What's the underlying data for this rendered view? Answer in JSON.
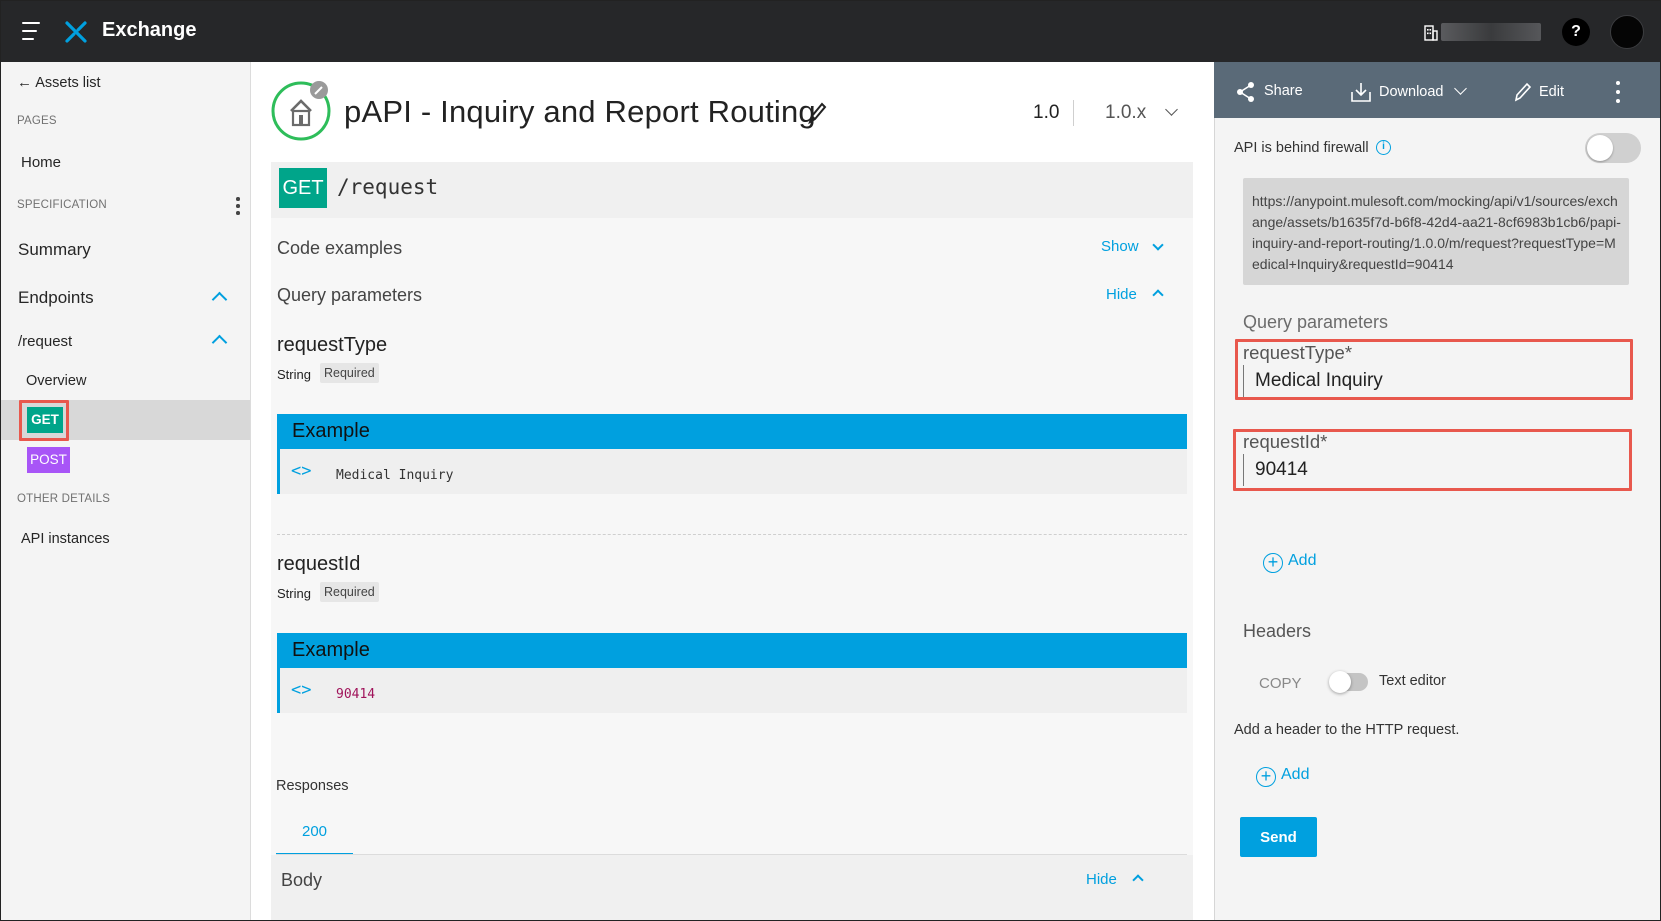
{
  "topbar": {
    "app_title": "Exchange",
    "help_label": "?"
  },
  "sidebar": {
    "back_label": "Assets list",
    "pages_title": "PAGES",
    "home_label": "Home",
    "spec_title": "SPECIFICATION",
    "summary_label": "Summary",
    "endpoints_label": "Endpoints",
    "resource_label": "/request",
    "overview_label": "Overview",
    "get_label": "GET",
    "post_label": "POST",
    "other_title": "OTHER DETAILS",
    "api_instances_label": "API instances"
  },
  "asset": {
    "title": "pAPI - Inquiry and Report Routing",
    "version": "1.0",
    "version_selector": "1.0.x"
  },
  "endpoint": {
    "method": "GET",
    "path": "/request",
    "code_examples_label": "Code examples",
    "show_label": "Show",
    "query_params_label": "Query parameters",
    "hide_label": "Hide",
    "params": [
      {
        "name": "requestType",
        "type": "String",
        "required": "Required",
        "example_title": "Example",
        "example_value": "Medical Inquiry"
      },
      {
        "name": "requestId",
        "type": "String",
        "required": "Required",
        "example_title": "Example",
        "example_value": "90414"
      }
    ],
    "responses_label": "Responses",
    "response_tab": "200",
    "body_label": "Body",
    "body_hide_label": "Hide"
  },
  "console": {
    "share_label": "Share",
    "download_label": "Download",
    "edit_label": "Edit",
    "firewall_label": "API is behind firewall",
    "firewall_info": "i",
    "url": "https://anypoint.mulesoft.com/mocking/api/v1/sources/exchange/assets/b1635f7d-b6f8-42d4-aa21-8cf6983b1cb6/papi-inquiry-and-report-routing/1.0.0/m/request?requestType=Medical+Inquiry&requestId=90414",
    "query_params_label": "Query parameters",
    "fields": [
      {
        "label": "requestType*",
        "value": "Medical Inquiry"
      },
      {
        "label": "requestId*",
        "value": "90414"
      }
    ],
    "add_label": "Add",
    "headers_label": "Headers",
    "copy_label": "COPY",
    "text_editor_label": "Text editor",
    "header_hint": "Add a header to the HTTP request.",
    "send_label": "Send"
  },
  "colors": {
    "topbar": "#262729",
    "accent": "#00a0df",
    "get_method": "#00a58a",
    "post_method": "#a855f7",
    "highlight": "#e8584d",
    "console_bar": "#5a6a78"
  }
}
